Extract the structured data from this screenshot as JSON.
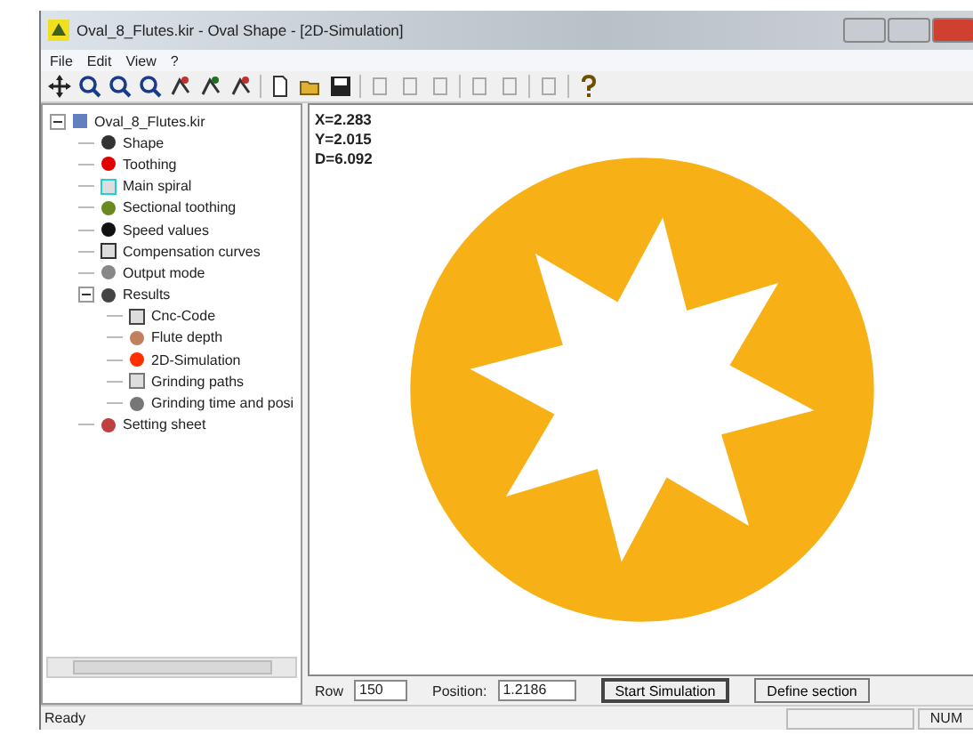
{
  "window": {
    "title": "Oval_8_Flutes.kir - Oval Shape - [2D-Simulation]"
  },
  "menu": [
    "File",
    "Edit",
    "View",
    "?"
  ],
  "toolbar": [
    {
      "disabled": false
    },
    {
      "disabled": false
    },
    {
      "disabled": false
    },
    {
      "disabled": false
    },
    {
      "disabled": false
    },
    {
      "disabled": false
    },
    {
      "disabled": false
    },
    {
      "disabled": false
    },
    {
      "disabled": false
    },
    {
      "disabled": false
    },
    {
      "disabled": true
    },
    {
      "disabled": true
    },
    {
      "disabled": true
    },
    {
      "disabled": true
    },
    {
      "disabled": true
    },
    {
      "disabled": true
    },
    {
      "disabled": false
    }
  ],
  "tree": [
    {
      "label": "Oval_8_Flutes.kir",
      "expanded": true,
      "children": [
        {
          "label": "Shape"
        },
        {
          "label": "Toothing"
        },
        {
          "label": "Main spiral"
        },
        {
          "label": "Sectional toothing"
        },
        {
          "label": "Speed values"
        },
        {
          "label": "Compensation curves"
        },
        {
          "label": "Output mode"
        },
        {
          "label": "Results",
          "expanded": true,
          "children": [
            {
              "label": "Cnc-Code"
            },
            {
              "label": "Flute depth"
            },
            {
              "label": "2D-Simulation"
            },
            {
              "label": "Grinding paths"
            },
            {
              "label": "Grinding time and posi"
            }
          ]
        },
        {
          "label": "Setting sheet"
        }
      ]
    }
  ],
  "readout": [
    "X=2.283",
    "Y=2.015",
    "D=6.092"
  ],
  "controls": {
    "row_label": "Row",
    "row_value": "150",
    "position_label": "Position:",
    "position_value": "1.2186",
    "buttons": [
      "Start Simulation",
      "Define section"
    ]
  },
  "status_bar": {
    "message": "Ready",
    "num": "NUM"
  }
}
